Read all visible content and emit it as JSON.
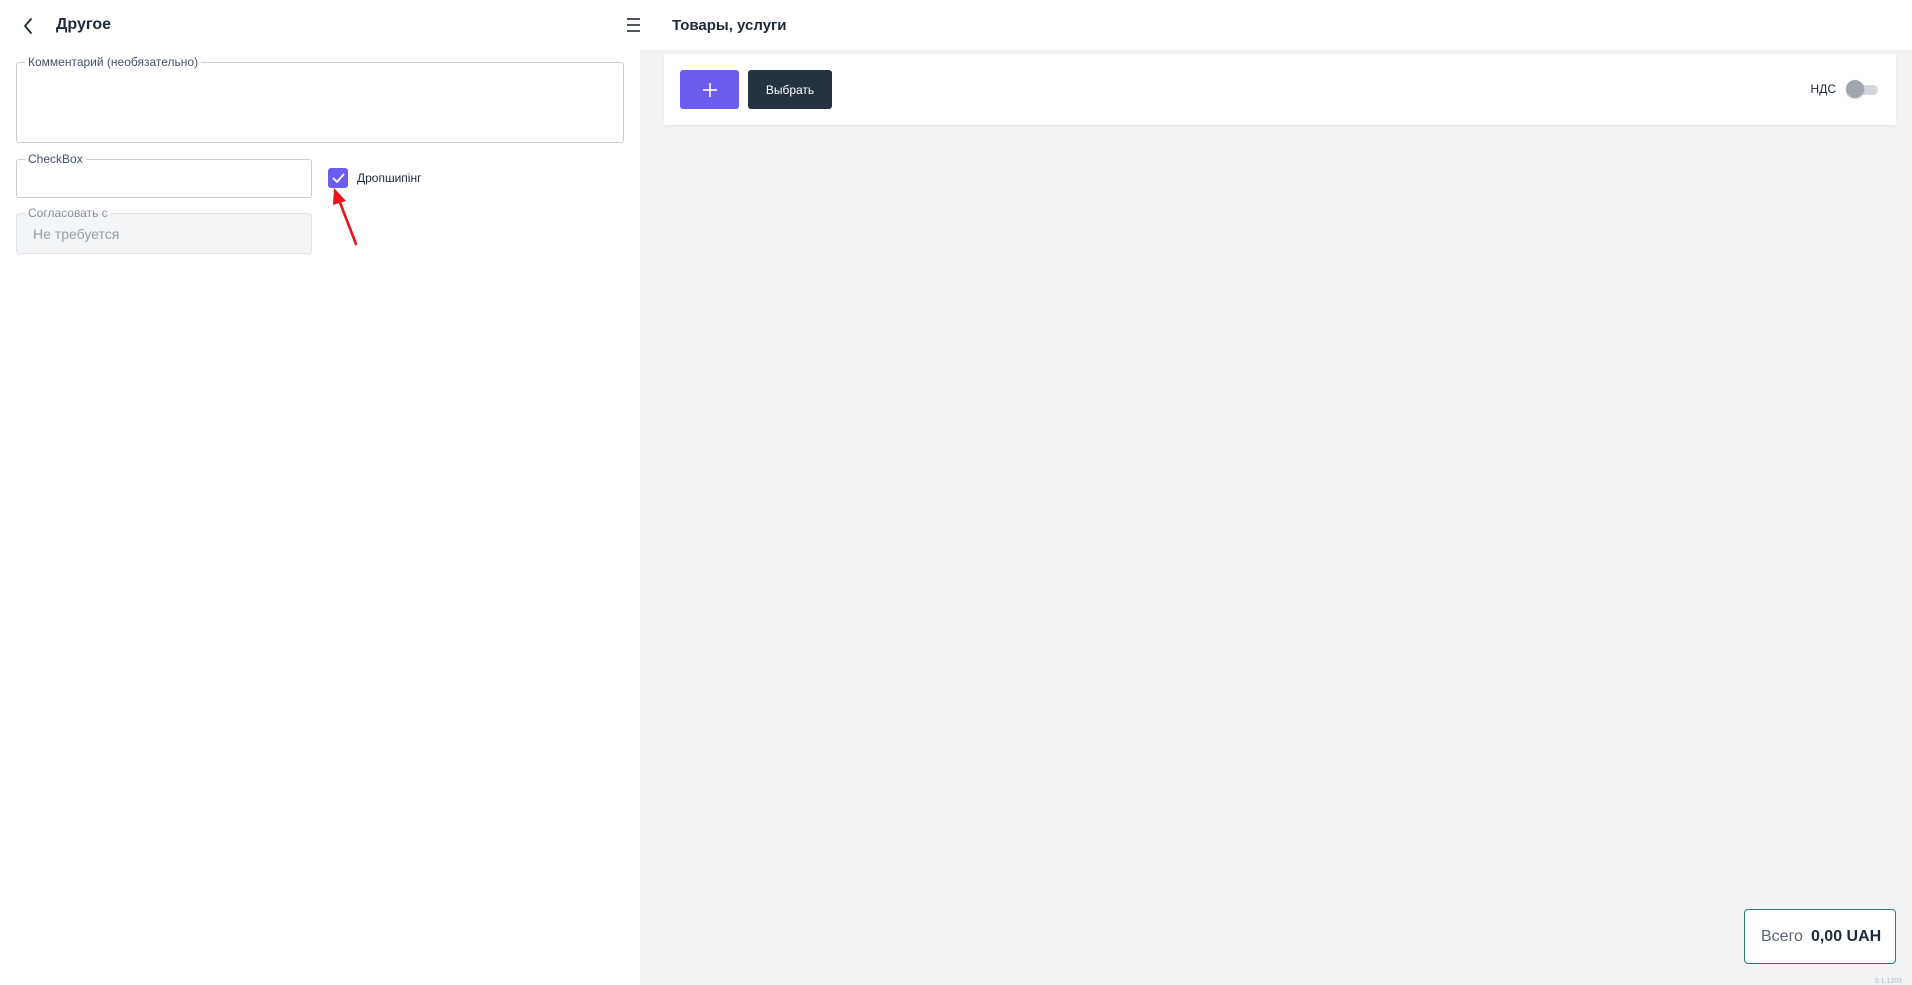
{
  "left": {
    "title": "Другое",
    "comment": {
      "legend": "Комментарий (необязательно)",
      "value": ""
    },
    "checkbox_field": {
      "legend": "CheckBox",
      "value": ""
    },
    "dropshipping": {
      "label": "Дропшипінг",
      "checked": true
    },
    "approve": {
      "legend": "Согласовать с",
      "placeholder": "Не требуется"
    }
  },
  "right": {
    "title": "Товары, услуги",
    "select_label": "Выбрать",
    "vat_label": "НДС",
    "vat_enabled": false,
    "total": {
      "label": "Всего",
      "value": "0,00 UAH"
    },
    "version": "0.1.1203"
  },
  "colors": {
    "accent": "#6c5cf0",
    "dark_button": "#253341",
    "total_border": "#2f7b6d",
    "annotation_arrow": "#e8141b"
  },
  "icons": {
    "back": "chevron-left-icon",
    "menu": "hamburger-menu-icon",
    "add": "plus-icon",
    "check": "checkmark-icon"
  }
}
